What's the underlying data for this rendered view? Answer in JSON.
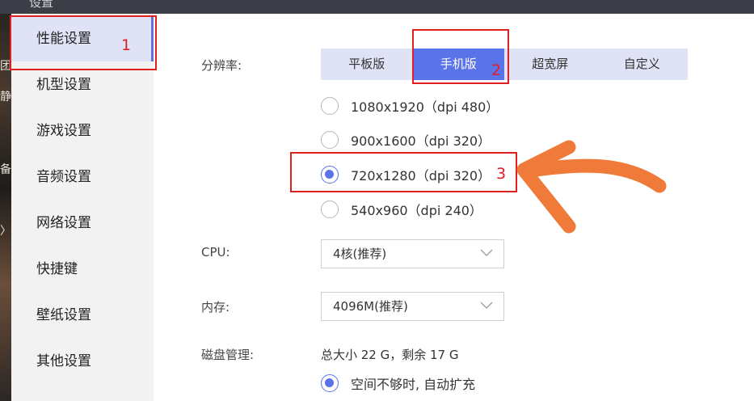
{
  "window": {
    "title": "设置"
  },
  "background_fragments": [
    "团",
    "静",
    "备",
    "〉"
  ],
  "sidebar": {
    "items": [
      {
        "label": "性能设置",
        "active": true
      },
      {
        "label": "机型设置"
      },
      {
        "label": "游戏设置"
      },
      {
        "label": "音频设置"
      },
      {
        "label": "网络设置"
      },
      {
        "label": "快捷键"
      },
      {
        "label": "壁纸设置"
      },
      {
        "label": "其他设置"
      }
    ]
  },
  "resolution": {
    "label": "分辨率:",
    "tabs": [
      {
        "label": "平板版"
      },
      {
        "label": "手机版",
        "active": true
      },
      {
        "label": "超宽屏"
      },
      {
        "label": "自定义"
      }
    ],
    "options": [
      {
        "label": "1080x1920（dpi 480）",
        "checked": false
      },
      {
        "label": "900x1600（dpi 320）",
        "checked": false
      },
      {
        "label": "720x1280（dpi 320）",
        "checked": true
      },
      {
        "label": "540x960（dpi 240）",
        "checked": false
      }
    ]
  },
  "cpu": {
    "label": "CPU:",
    "value": "4核(推荐)"
  },
  "memory": {
    "label": "内存:",
    "value": "4096M(推荐)"
  },
  "disk": {
    "label": "磁盘管理:",
    "info": "总大小 22 G，剩余 17 G",
    "option": {
      "label": "空间不够时, 自动扩充",
      "checked": true
    }
  },
  "annotations": {
    "numbers": [
      "1",
      "2",
      "3"
    ],
    "box_color": "#e02020",
    "arrow_color": "#f07a3a"
  },
  "colors": {
    "accent": "#5b73e8",
    "tab_bg": "#dfe3f5",
    "sidebar_bg": "#f2f2f2"
  }
}
